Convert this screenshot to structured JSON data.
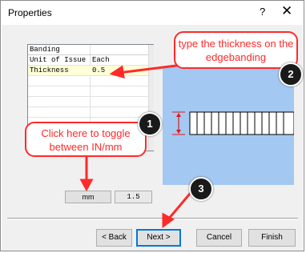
{
  "window": {
    "title": "Properties",
    "help_glyph": "?",
    "close_glyph": "✕"
  },
  "grid": {
    "header": "Banding",
    "rows": [
      {
        "label": "Unit of Issue",
        "value": "Each"
      },
      {
        "label": "Thickness",
        "value": "0.5"
      }
    ]
  },
  "units": {
    "toggle_label": "mm",
    "thickness_value": "1.5"
  },
  "buttons": {
    "back": "< Back",
    "next": "Next >",
    "cancel": "Cancel",
    "finish": "Finish"
  },
  "callouts": {
    "thickness": "type the thickness on the edgebanding",
    "toggle": "Click here to toggle between IN/mm"
  },
  "badges": {
    "one": "1",
    "two": "2",
    "three": "3"
  },
  "colors": {
    "callout_red": "#ff2a2a",
    "preview_blue": "#a3c8f1",
    "selected_row": "#ffffd8",
    "focus_blue": "#0078d7"
  }
}
